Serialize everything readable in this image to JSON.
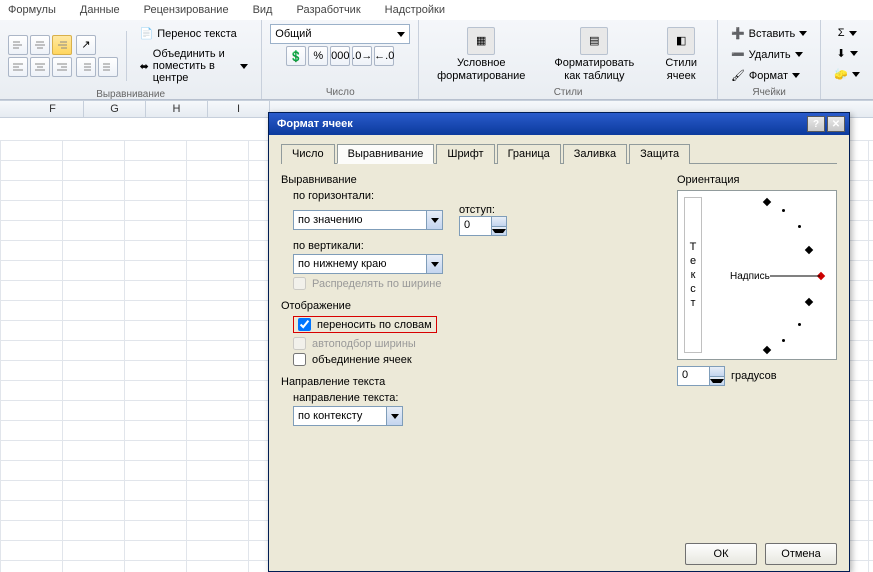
{
  "menu": {
    "items": [
      "Формулы",
      "Данные",
      "Рецензирование",
      "Вид",
      "Разработчик",
      "Надстройки"
    ]
  },
  "ribbon": {
    "align": {
      "label": "Выравнивание",
      "wrap": "Перенос текста",
      "merge": "Объединить и поместить в центре"
    },
    "number": {
      "label": "Число",
      "format": "Общий",
      "btns": [
        "%",
        "000"
      ]
    },
    "styles": {
      "label": "Стили",
      "cond": "Условное форматирование",
      "table": "Форматировать как таблицу",
      "cell": "Стили ячеек"
    },
    "cells": {
      "label": "Ячейки",
      "insert": "Вставить",
      "delete": "Удалить",
      "format": "Формат"
    },
    "sigma": "Σ"
  },
  "cols": [
    "F",
    "G",
    "H",
    "I"
  ],
  "dialog": {
    "title": "Формат ячеек",
    "tabs": [
      "Число",
      "Выравнивание",
      "Шрифт",
      "Граница",
      "Заливка",
      "Защита"
    ],
    "active_tab": "Выравнивание",
    "align_section": "Выравнивание",
    "h_label": "по горизонтали:",
    "h_value": "по значению",
    "indent_label": "отступ:",
    "indent_value": "0",
    "v_label": "по вертикали:",
    "v_value": "по нижнему краю",
    "distribute": "Распределять по ширине",
    "display_section": "Отображение",
    "wrap": "переносить по словам",
    "autofit": "автоподбор ширины",
    "merge": "объединение ячеек",
    "dir_section": "Направление текста",
    "dir_label": "направление текста:",
    "dir_value": "по контексту",
    "orient_section": "Ориентация",
    "orient_vertical": [
      "Т",
      "е",
      "к",
      "с",
      "т"
    ],
    "orient_label": "Надпись",
    "degrees_value": "0",
    "degrees_label": "градусов",
    "ok": "ОК",
    "cancel": "Отмена"
  }
}
